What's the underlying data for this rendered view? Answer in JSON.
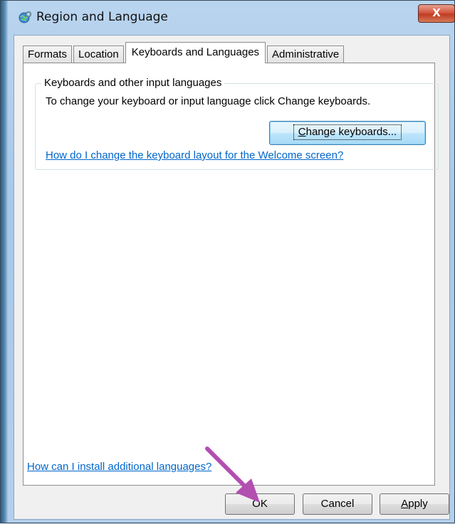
{
  "window": {
    "title": "Region and Language",
    "close_label": "X"
  },
  "tabs": [
    {
      "label": "Formats",
      "active": false
    },
    {
      "label": "Location",
      "active": false
    },
    {
      "label": "Keyboards and Languages",
      "active": true
    },
    {
      "label": "Administrative",
      "active": false
    }
  ],
  "keyboards_group": {
    "title": "Keyboards and other input languages",
    "description": "To change your keyboard or input language click Change keyboards.",
    "change_button": {
      "mnemonic": "C",
      "rest": "hange keyboards..."
    },
    "welcome_link": "How do I change the keyboard layout for the Welcome screen?"
  },
  "install_link": "How can I install additional languages?",
  "buttons": {
    "ok": "OK",
    "cancel": "Cancel",
    "apply": {
      "mnemonic": "A",
      "rest": "pply"
    }
  },
  "annotation": {
    "arrow_color": "#b24fb0",
    "points_to": "OK"
  }
}
